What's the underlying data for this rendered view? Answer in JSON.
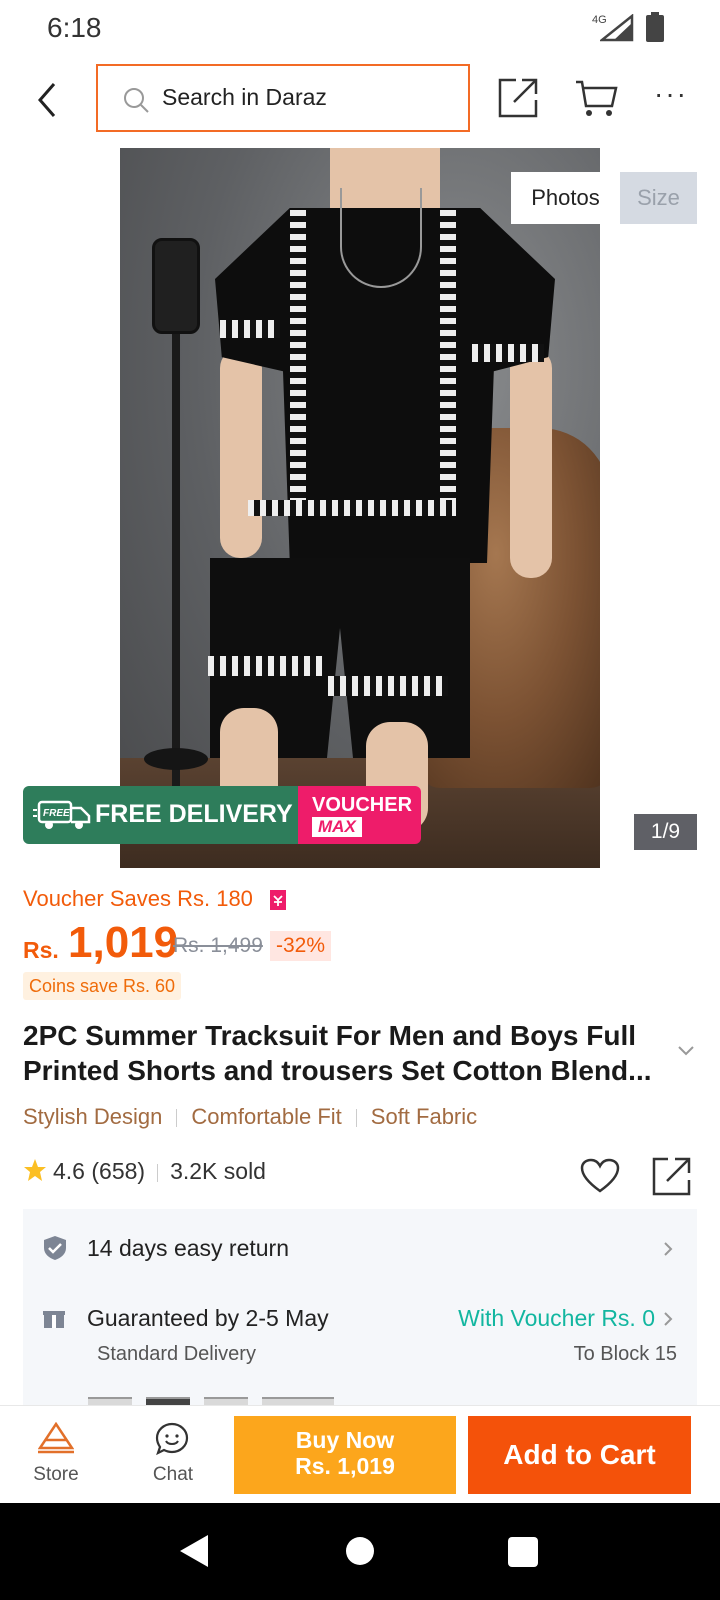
{
  "status_bar": {
    "time": "6:18",
    "network": "4G"
  },
  "header": {
    "search_placeholder": "Search in Daraz"
  },
  "gallery": {
    "tab_photos": "Photos",
    "tab_size": "Size",
    "counter": "1/9"
  },
  "promo": {
    "free_badge": "FREE",
    "free_delivery": "FREE DELIVERY",
    "voucher": "VOUCHER",
    "max": "MAX"
  },
  "price": {
    "voucher_saves": "Voucher Saves Rs. 180",
    "currency": "Rs.",
    "value": "1,019",
    "original": "Rs. 1,499",
    "discount": "-32%",
    "coins": "Coins save Rs. 60"
  },
  "product": {
    "title": "2PC Summer Tracksuit For Men and Boys Full Printed Shorts and trousers Set Cotton Blend...",
    "features": [
      "Stylish Design",
      "Comfortable Fit",
      "Soft Fabric"
    ],
    "rating": "4.6",
    "reviews": "(658)",
    "sold": "3.2K sold"
  },
  "service": {
    "returns": "14 days easy return",
    "guarantee": "Guaranteed by 2-5 May",
    "delivery_type": "Standard Delivery",
    "voucher": "With Voucher Rs. 0",
    "destination": "To Block 15"
  },
  "bottom_bar": {
    "store": "Store",
    "chat": "Chat",
    "buy_now": "Buy Now",
    "buy_now_price": "Rs. 1,019",
    "add_to_cart": "Add to Cart"
  },
  "colors": {
    "accent": "#f36b25",
    "price": "#f25b0a",
    "buy_now": "#fca61c",
    "add_to_cart": "#f4520a",
    "voucher_teal": "#12b6a0"
  }
}
